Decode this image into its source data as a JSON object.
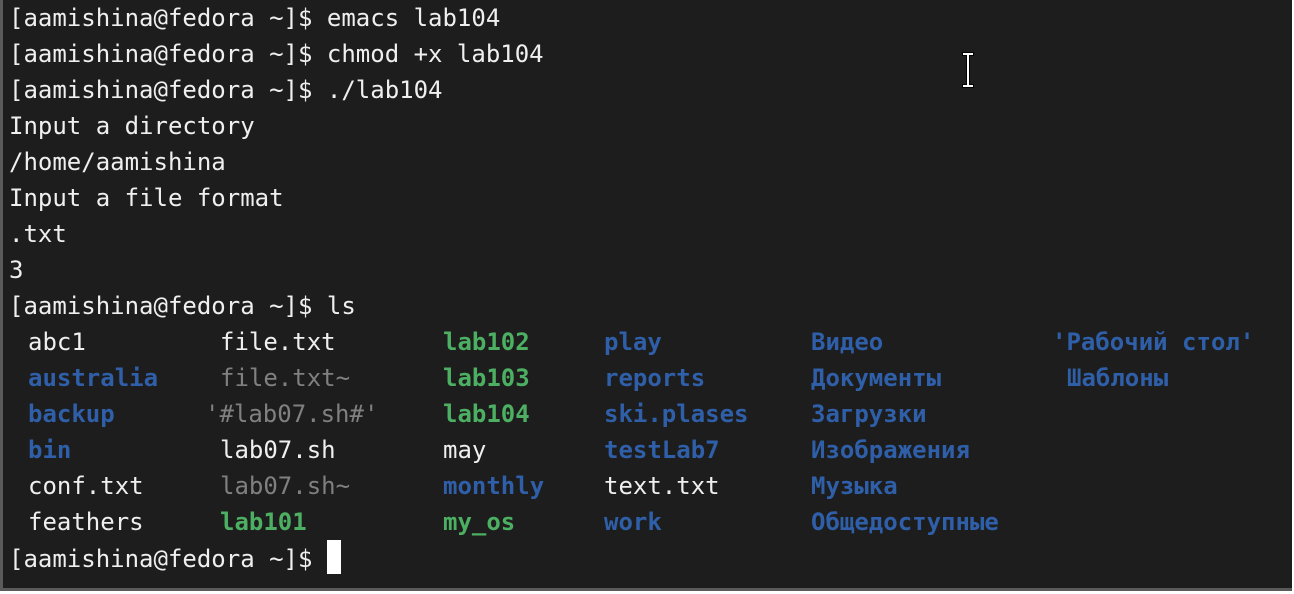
{
  "prompt": "[aamishina@fedora ~]$ ",
  "commands": {
    "c1": "emacs lab104",
    "c2": "chmod +x lab104",
    "c3": "./lab104",
    "c4": "ls"
  },
  "output": {
    "o1": "Input a directory",
    "o2": "/home/aamishina",
    "o3": "Input a file format",
    "o4": ".txt",
    "o5": "3"
  },
  "ls": {
    "c1": [
      "abc1",
      "australia",
      "backup",
      "bin",
      "conf.txt",
      "feathers"
    ],
    "c2": [
      "file.txt",
      "file.txt~",
      "'#lab07.sh#'",
      "lab07.sh",
      "lab07.sh~",
      "lab101"
    ],
    "c3": [
      "lab102",
      "lab103",
      "lab104",
      "may",
      "monthly",
      "my_os"
    ],
    "c4": [
      "play",
      "reports",
      "ski.plases",
      "testLab7",
      "text.txt",
      "work"
    ],
    "c5": [
      "Видео",
      "Документы",
      "Загрузки",
      "Изображения",
      "Музыка",
      "Общедоступные"
    ],
    "c6": [
      "'Рабочий стол'",
      "Шаблоны"
    ]
  },
  "colors": {
    "background": "#1d1d1d",
    "text": "#efefef",
    "directory": "#2f5fa8",
    "executable": "#4caf62",
    "backup": "#808080"
  }
}
